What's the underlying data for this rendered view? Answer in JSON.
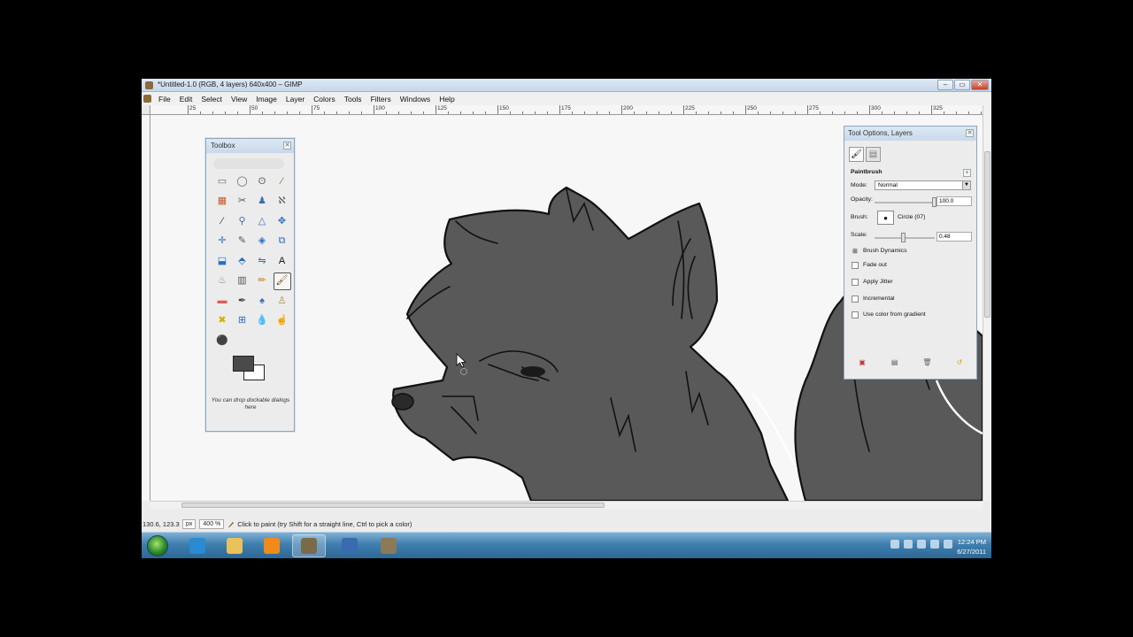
{
  "window": {
    "title": "*Untitled-1.0 (RGB, 4 layers) 640x400 – GIMP",
    "controls": {
      "minimize": "–",
      "maximize": "▭",
      "close": "✕"
    }
  },
  "menu": [
    "File",
    "Edit",
    "Select",
    "View",
    "Image",
    "Layer",
    "Colors",
    "Tools",
    "Filters",
    "Windows",
    "Help"
  ],
  "ruler": {
    "labels": [
      "25",
      "50",
      "75",
      "100",
      "125",
      "150",
      "175",
      "200",
      "225",
      "250",
      "275",
      "300",
      "325"
    ]
  },
  "toolbox": {
    "title": "Toolbox",
    "hint": "You can drop dockable dialogs here",
    "tools": [
      {
        "icon": "rect-select-icon",
        "glyph": "▭",
        "color": "#666666"
      },
      {
        "icon": "ellipse-select-icon",
        "glyph": "◯",
        "color": "#666666"
      },
      {
        "icon": "free-select-icon",
        "glyph": "ʘ",
        "color": "#666666"
      },
      {
        "icon": "fuzzy-select-icon",
        "glyph": "⁄",
        "color": "#8a6a2a"
      },
      {
        "icon": "select-by-color-icon",
        "glyph": "▦",
        "color": "#c65a2a"
      },
      {
        "icon": "scissors-select-icon",
        "glyph": "✂",
        "color": "#555555"
      },
      {
        "icon": "foreground-select-icon",
        "glyph": "♟",
        "color": "#3a6fb0"
      },
      {
        "icon": "paths-icon",
        "glyph": "ℵ",
        "color": "#555555"
      },
      {
        "icon": "color-picker-icon",
        "glyph": "⁄",
        "color": "#333333"
      },
      {
        "icon": "zoom-icon",
        "glyph": "⚲",
        "color": "#3a6fb0"
      },
      {
        "icon": "measure-icon",
        "glyph": "△",
        "color": "#3a6fb0"
      },
      {
        "icon": "move-icon",
        "glyph": "✥",
        "color": "#2a6fc0"
      },
      {
        "icon": "align-icon",
        "glyph": "✛",
        "color": "#2a6fc0"
      },
      {
        "icon": "crop-icon",
        "glyph": "✎",
        "color": "#555555"
      },
      {
        "icon": "rotate-icon",
        "glyph": "◈",
        "color": "#2a6fc0"
      },
      {
        "icon": "scale-icon",
        "glyph": "⧉",
        "color": "#2a6fc0"
      },
      {
        "icon": "shear-icon",
        "glyph": "⬓",
        "color": "#2a6fc0"
      },
      {
        "icon": "perspective-icon",
        "glyph": "⬘",
        "color": "#2a6fc0"
      },
      {
        "icon": "flip-icon",
        "glyph": "⇋",
        "color": "#2a6fc0"
      },
      {
        "icon": "text-icon",
        "glyph": "A",
        "color": "#111111"
      },
      {
        "icon": "bucket-fill-icon",
        "glyph": "♨",
        "color": "#888888"
      },
      {
        "icon": "blend-icon",
        "glyph": "▥",
        "color": "#555555"
      },
      {
        "icon": "pencil-icon",
        "glyph": "✏",
        "color": "#c68a1a"
      },
      {
        "icon": "paintbrush-icon",
        "glyph": "🖌",
        "color": "#7a4a1a",
        "active": true
      },
      {
        "icon": "eraser-icon",
        "glyph": "▬",
        "color": "#e05a5a"
      },
      {
        "icon": "airbrush-icon",
        "glyph": "✒",
        "color": "#444444"
      },
      {
        "icon": "ink-icon",
        "glyph": "♠",
        "color": "#3a6fb0"
      },
      {
        "icon": "clone-icon",
        "glyph": "♙",
        "color": "#b08a3a"
      },
      {
        "icon": "heal-icon",
        "glyph": "✖",
        "color": "#d4b000"
      },
      {
        "icon": "perspective-clone-icon",
        "glyph": "⊞",
        "color": "#2a6fc0"
      },
      {
        "icon": "blur-icon",
        "glyph": "💧",
        "color": "#5a8ac0"
      },
      {
        "icon": "smudge-icon",
        "glyph": "☝",
        "color": "#c08a3a"
      },
      {
        "icon": "dodge-burn-icon",
        "glyph": "⚫",
        "color": "#333333"
      }
    ],
    "fg_color": "#4a4a4a",
    "bg_color": "#ffffff"
  },
  "tool_options": {
    "title": "Tool Options, Layers",
    "tool_name": "Paintbrush",
    "mode_label": "Mode:",
    "mode_value": "Normal",
    "opacity_label": "Opacity:",
    "opacity_value": "100.0",
    "opacity_level": 1.0,
    "brush_label": "Brush:",
    "brush_value": "Circle (07)",
    "scale_label": "Scale:",
    "scale_value": "0.48",
    "scale_level": 0.48,
    "options": [
      {
        "label": "Brush Dynamics",
        "checked": false,
        "expander": true
      },
      {
        "label": "Fade out",
        "checked": false
      },
      {
        "label": "Apply Jitter",
        "checked": false
      },
      {
        "label": "Incremental",
        "checked": false
      },
      {
        "label": "Use color from gradient",
        "checked": false
      }
    ]
  },
  "status": {
    "coords": "130.6, 123.3",
    "unit": "px",
    "zoom": "400 %",
    "message": "Click to paint (try Shift for a straight line, Ctrl to pick a color)"
  },
  "taskbar": {
    "time": "12:24 PM",
    "date": "6/27/2011",
    "apps": [
      {
        "icon": "ie-icon",
        "color": "#2a8ad4"
      },
      {
        "icon": "explorer-icon",
        "color": "#e9c25a"
      },
      {
        "icon": "media-player-icon",
        "color": "#f08a1a"
      },
      {
        "icon": "gimp-icon",
        "color": "#7a6a4a",
        "active": true
      },
      {
        "icon": "screen-recorder-icon",
        "color": "#3a6ab0"
      },
      {
        "icon": "paint-tool-icon",
        "color": "#8a7a5a"
      }
    ]
  }
}
